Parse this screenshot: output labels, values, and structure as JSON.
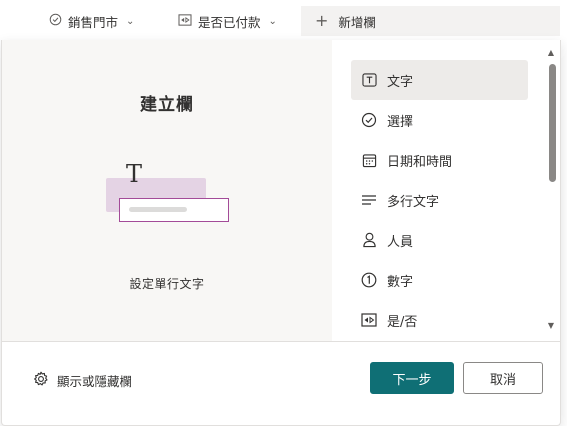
{
  "columns": {
    "sales_store": "銷售門市",
    "paid": "是否已付款",
    "add_column": "新增欄"
  },
  "panel": {
    "title": "建立欄",
    "description": "設定單行文字",
    "illustration_glyph": "T"
  },
  "column_types": [
    {
      "label": "文字",
      "icon": "text-type-icon",
      "selected": true
    },
    {
      "label": "選擇",
      "icon": "choice-check-icon"
    },
    {
      "label": "日期和時間",
      "icon": "calendar-icon"
    },
    {
      "label": "多行文字",
      "icon": "multiline-text-icon"
    },
    {
      "label": "人員",
      "icon": "person-icon"
    },
    {
      "label": "數字",
      "icon": "number-icon"
    },
    {
      "label": "是/否",
      "icon": "yes-no-icon"
    }
  ],
  "footer": {
    "toggle_columns": "顯示或隱藏欄",
    "next": "下一步",
    "cancel": "取消"
  },
  "colors": {
    "primary_button": "#0f6f75",
    "selected_item": "#edebe9",
    "illustration_accent": "#a34b98",
    "left_pane_bg": "#f8f7f5"
  }
}
